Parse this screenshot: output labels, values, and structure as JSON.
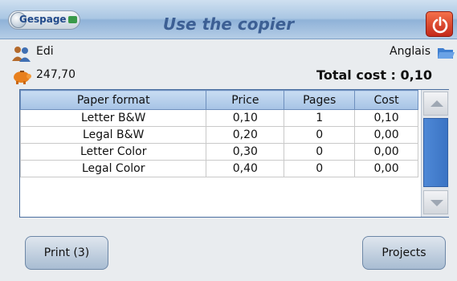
{
  "header": {
    "logo_text": "Gespage",
    "title": "Use the copier"
  },
  "user": {
    "name": "Edi",
    "balance": "247,70",
    "language": "Anglais",
    "total_cost": "Total cost : 0,10"
  },
  "table": {
    "columns": [
      "Paper format",
      "Price",
      "Pages",
      "Cost"
    ],
    "rows": [
      [
        "Letter B&W",
        "0,10",
        "1",
        "0,10"
      ],
      [
        "Legal B&W",
        "0,20",
        "0",
        "0,00"
      ],
      [
        "Letter Color",
        "0,30",
        "0",
        "0,00"
      ],
      [
        "Legal Color",
        "0,40",
        "0",
        "0,00"
      ]
    ]
  },
  "buttons": {
    "print_label": "Print (3)",
    "projects_label": "Projects"
  },
  "colors": {
    "header_title": "#3c5f94",
    "power_button": "#d9391f",
    "scroll_thumb": "#3b74c4",
    "table_header": "#a6c3e5"
  },
  "icons": {
    "power": "power-icon",
    "user": "user-icon",
    "folder": "folder-icon",
    "balance": "piggy-bank-icon",
    "scroll_up": "arrow-up-icon",
    "scroll_down": "arrow-down-icon"
  }
}
